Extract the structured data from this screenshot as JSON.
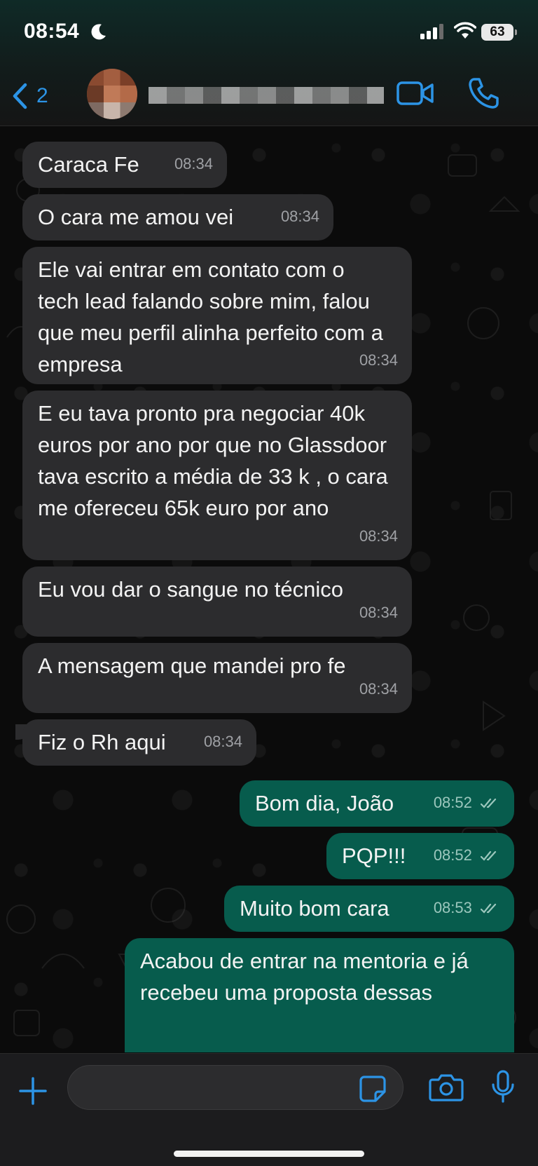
{
  "status_bar": {
    "time": "08:54",
    "battery": "63"
  },
  "header": {
    "back_count": "2",
    "contact_name": ""
  },
  "messages": [
    {
      "dir": "in",
      "text": "Caraca Fe",
      "time": "08:34"
    },
    {
      "dir": "in",
      "text": "O cara me amou vei",
      "time": "08:34"
    },
    {
      "dir": "in",
      "text": "Ele vai entrar em contato com o tech lead falando sobre mim, falou que meu perfil alinha perfeito com a empresa",
      "time": "08:34"
    },
    {
      "dir": "in",
      "text": "E eu tava pronto pra negociar 40k euros por ano por que no Glassdoor tava escrito a média de 33 k , o cara me ofereceu 65k euro por ano",
      "time": "08:34"
    },
    {
      "dir": "in",
      "text": "Eu vou dar o sangue no técnico",
      "time": "08:34"
    },
    {
      "dir": "in",
      "text": "A mensagem que mandei pro fe",
      "time": "08:34"
    },
    {
      "dir": "in",
      "text": "Fiz o Rh aqui",
      "time": "08:34"
    },
    {
      "dir": "out",
      "text": "Bom dia, João",
      "time": "08:52"
    },
    {
      "dir": "out",
      "text": "PQP!!!",
      "time": "08:52"
    },
    {
      "dir": "out",
      "text": "Muito bom cara",
      "time": "08:53"
    },
    {
      "dir": "out",
      "text": "Acabou de entrar na mentoria e já recebeu uma proposta dessas",
      "time": ""
    }
  ],
  "composer": {
    "placeholder": "",
    "value": ""
  },
  "colors": {
    "accent": "#2c94e6",
    "incoming_bubble": "#2c2c2e",
    "outgoing_bubble": "#075c4d"
  },
  "icons": {
    "back": "chevron-left-icon",
    "video": "video-camera-icon",
    "call": "phone-icon",
    "plus": "plus-icon",
    "sticker": "sticker-icon",
    "camera": "camera-icon",
    "mic": "microphone-icon",
    "ticks": "double-check-icon",
    "dnd": "moon-icon"
  }
}
